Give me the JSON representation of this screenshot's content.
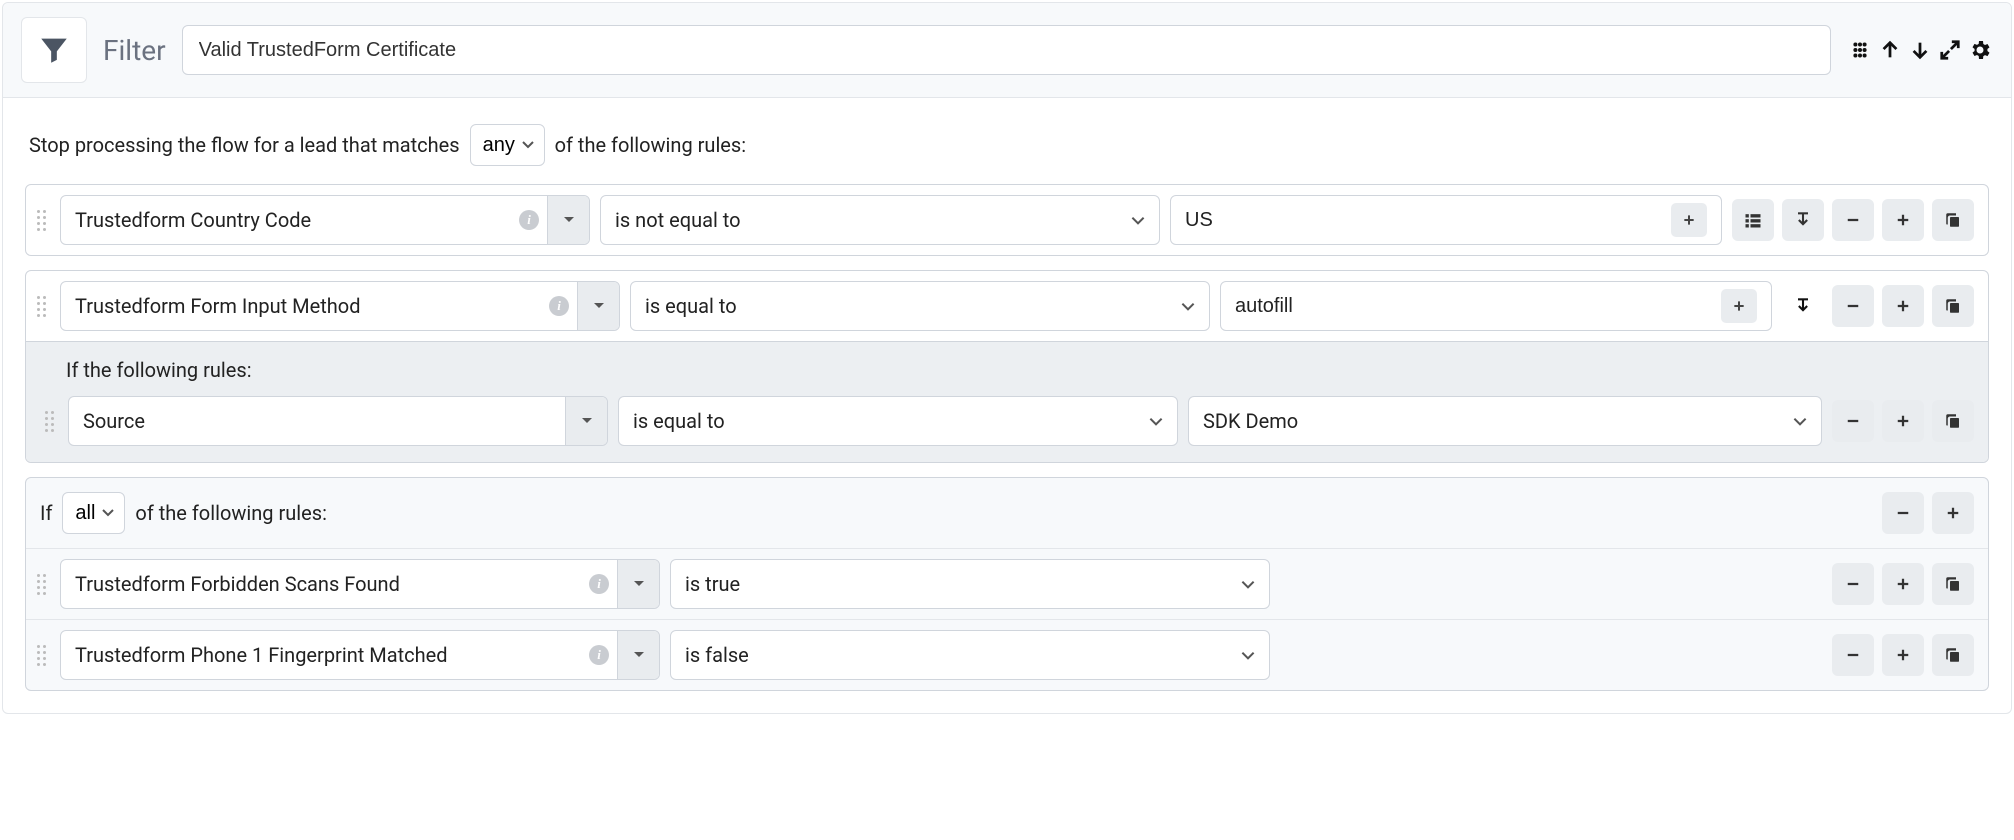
{
  "header": {
    "label": "Filter",
    "title": "Valid TrustedForm Certificate"
  },
  "intro": {
    "before": "Stop processing the flow for a lead that matches",
    "mode": "any",
    "after": "of the following rules:"
  },
  "rule1": {
    "field": "Trustedform Country Code",
    "op": "is not equal to",
    "value": "US"
  },
  "rule2": {
    "field": "Trustedform Form Input Method",
    "op": "is equal to",
    "value": "autofill",
    "sub_title": "If the following rules:",
    "sub_rule": {
      "field": "Source",
      "op": "is equal to",
      "value": "SDK Demo"
    }
  },
  "group": {
    "before": "If",
    "mode": "all",
    "after": "of the following rules:",
    "rules": [
      {
        "field": "Trustedform Forbidden Scans Found",
        "op": "is true"
      },
      {
        "field": "Trustedform Phone 1 Fingerprint Matched",
        "op": "is false"
      }
    ]
  }
}
